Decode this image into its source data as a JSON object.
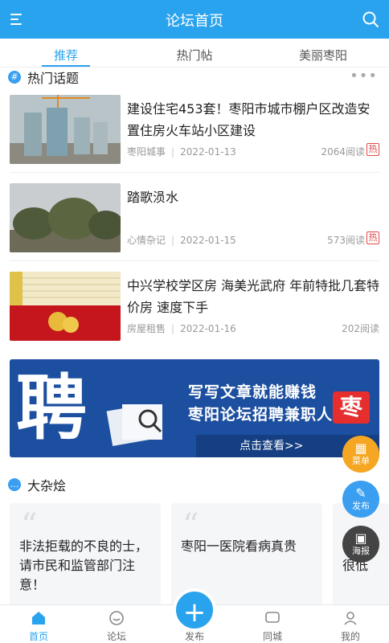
{
  "header": {
    "title": "论坛首页"
  },
  "tabs": [
    {
      "label": "推荐"
    },
    {
      "label": "热门帖"
    },
    {
      "label": "美丽枣阳"
    }
  ],
  "hot_topics": {
    "title": "热门话题",
    "items": [
      {
        "title": "建设住宅453套！枣阳市城市棚户区改造安置住房火车站小区建设",
        "category": "枣阳城事",
        "date": "2022-01-13",
        "views": "2064阅读",
        "hot": "热"
      },
      {
        "title": "踏歌涢水",
        "category": "心情杂记",
        "date": "2022-01-15",
        "views": "573阅读",
        "hot": "热"
      },
      {
        "title": "中兴学校学区房 海美光武府 年前特批几套特价房 速度下手",
        "category": "房屋租售",
        "date": "2022-01-16",
        "views": "202阅读"
      }
    ]
  },
  "banner": {
    "big_char": "聘",
    "line1": "写写文章就能赚钱",
    "line2": "枣阳论坛招聘兼职人员",
    "logo": "枣",
    "cta": "点击查看>>"
  },
  "misc": {
    "title": "大杂烩",
    "cards": [
      {
        "text": "非法拒载的不良的士，请市民和监管部门注意！"
      },
      {
        "text": "枣阳一医院看病真贵"
      },
      {
        "text": "零…\n很低"
      }
    ]
  },
  "fabs": [
    {
      "label": "菜单",
      "icon": "grid-icon",
      "color": "#f5a623"
    },
    {
      "label": "发布",
      "icon": "edit-icon",
      "color": "#3a9ef1"
    },
    {
      "label": "海报",
      "icon": "qrcode-icon",
      "color": "#444444"
    }
  ],
  "bottom_nav": [
    {
      "label": "首页"
    },
    {
      "label": "论坛"
    },
    {
      "label": "发布"
    },
    {
      "label": "同城"
    },
    {
      "label": "我的"
    }
  ],
  "colors": {
    "accent": "#2aa3ee",
    "hot": "#e24a4a"
  }
}
